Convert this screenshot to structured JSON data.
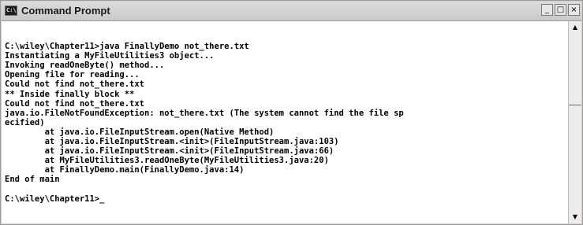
{
  "window": {
    "title": "Command Prompt",
    "icon_label": "C:\\",
    "controls": {
      "minimize": "_",
      "maximize": "□",
      "close": "×"
    }
  },
  "console": {
    "lines": [
      "",
      "C:\\wiley\\Chapter11>java FinallyDemo not_there.txt",
      "Instantiating a MyFileUtilities3 object...",
      "Invoking readOneByte() method...",
      "Opening file for reading...",
      "Could not find not_there.txt",
      "** Inside finally block **",
      "Could not find not_there.txt",
      "java.io.FileNotFoundException: not_there.txt (The system cannot find the file sp",
      "ecified)",
      "        at java.io.FileInputStream.open(Native Method)",
      "        at java.io.FileInputStream.<init>(FileInputStream.java:103)",
      "        at java.io.FileInputStream.<init>(FileInputStream.java:66)",
      "        at MyFileUtilities3.readOneByte(MyFileUtilities3.java:20)",
      "        at FinallyDemo.main(FinallyDemo.java:14)",
      "End of main",
      "",
      "C:\\wiley\\Chapter11>"
    ],
    "cursor": "_"
  },
  "scrollbar": {
    "up_arrow": "▲",
    "down_arrow": "▼"
  }
}
